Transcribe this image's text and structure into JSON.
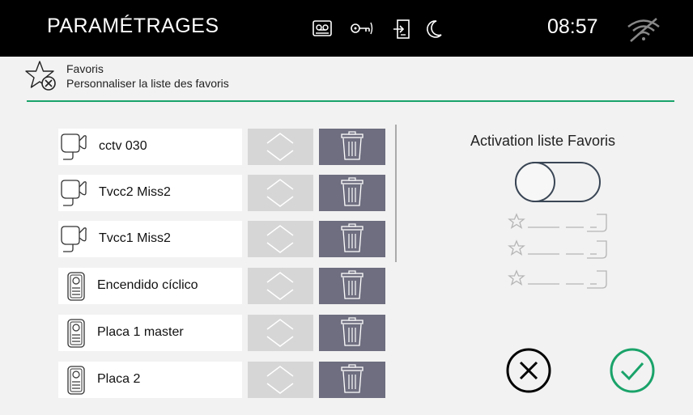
{
  "topbar": {
    "title": "PARAMÉTRAGES",
    "time": "08:57",
    "icons": [
      "voicemail-icon",
      "key-icon",
      "door-exit-icon",
      "moon-icon",
      "wifi-off-icon"
    ]
  },
  "header": {
    "title": "Favoris",
    "subtitle": "Personnaliser la liste des favoris",
    "icon": "star-remove-icon"
  },
  "favorites": [
    {
      "label": "cctv 030",
      "type": "camera"
    },
    {
      "label": "Tvcc2 Miss2",
      "type": "camera"
    },
    {
      "label": "Tvcc1 Miss2",
      "type": "camera"
    },
    {
      "label": "Encendido cíclico",
      "type": "entry-panel"
    },
    {
      "label": "Placa 1 master",
      "type": "entry-panel"
    },
    {
      "label": "Placa 2",
      "type": "entry-panel"
    }
  ],
  "activation": {
    "label": "Activation liste Favoris",
    "enabled": false
  },
  "colors": {
    "topbar": "#000000",
    "accent_green": "#1aa36a",
    "delete_button": "#6e6e80",
    "reorder_button": "#d6d6d6",
    "background": "#f2f2f2"
  }
}
